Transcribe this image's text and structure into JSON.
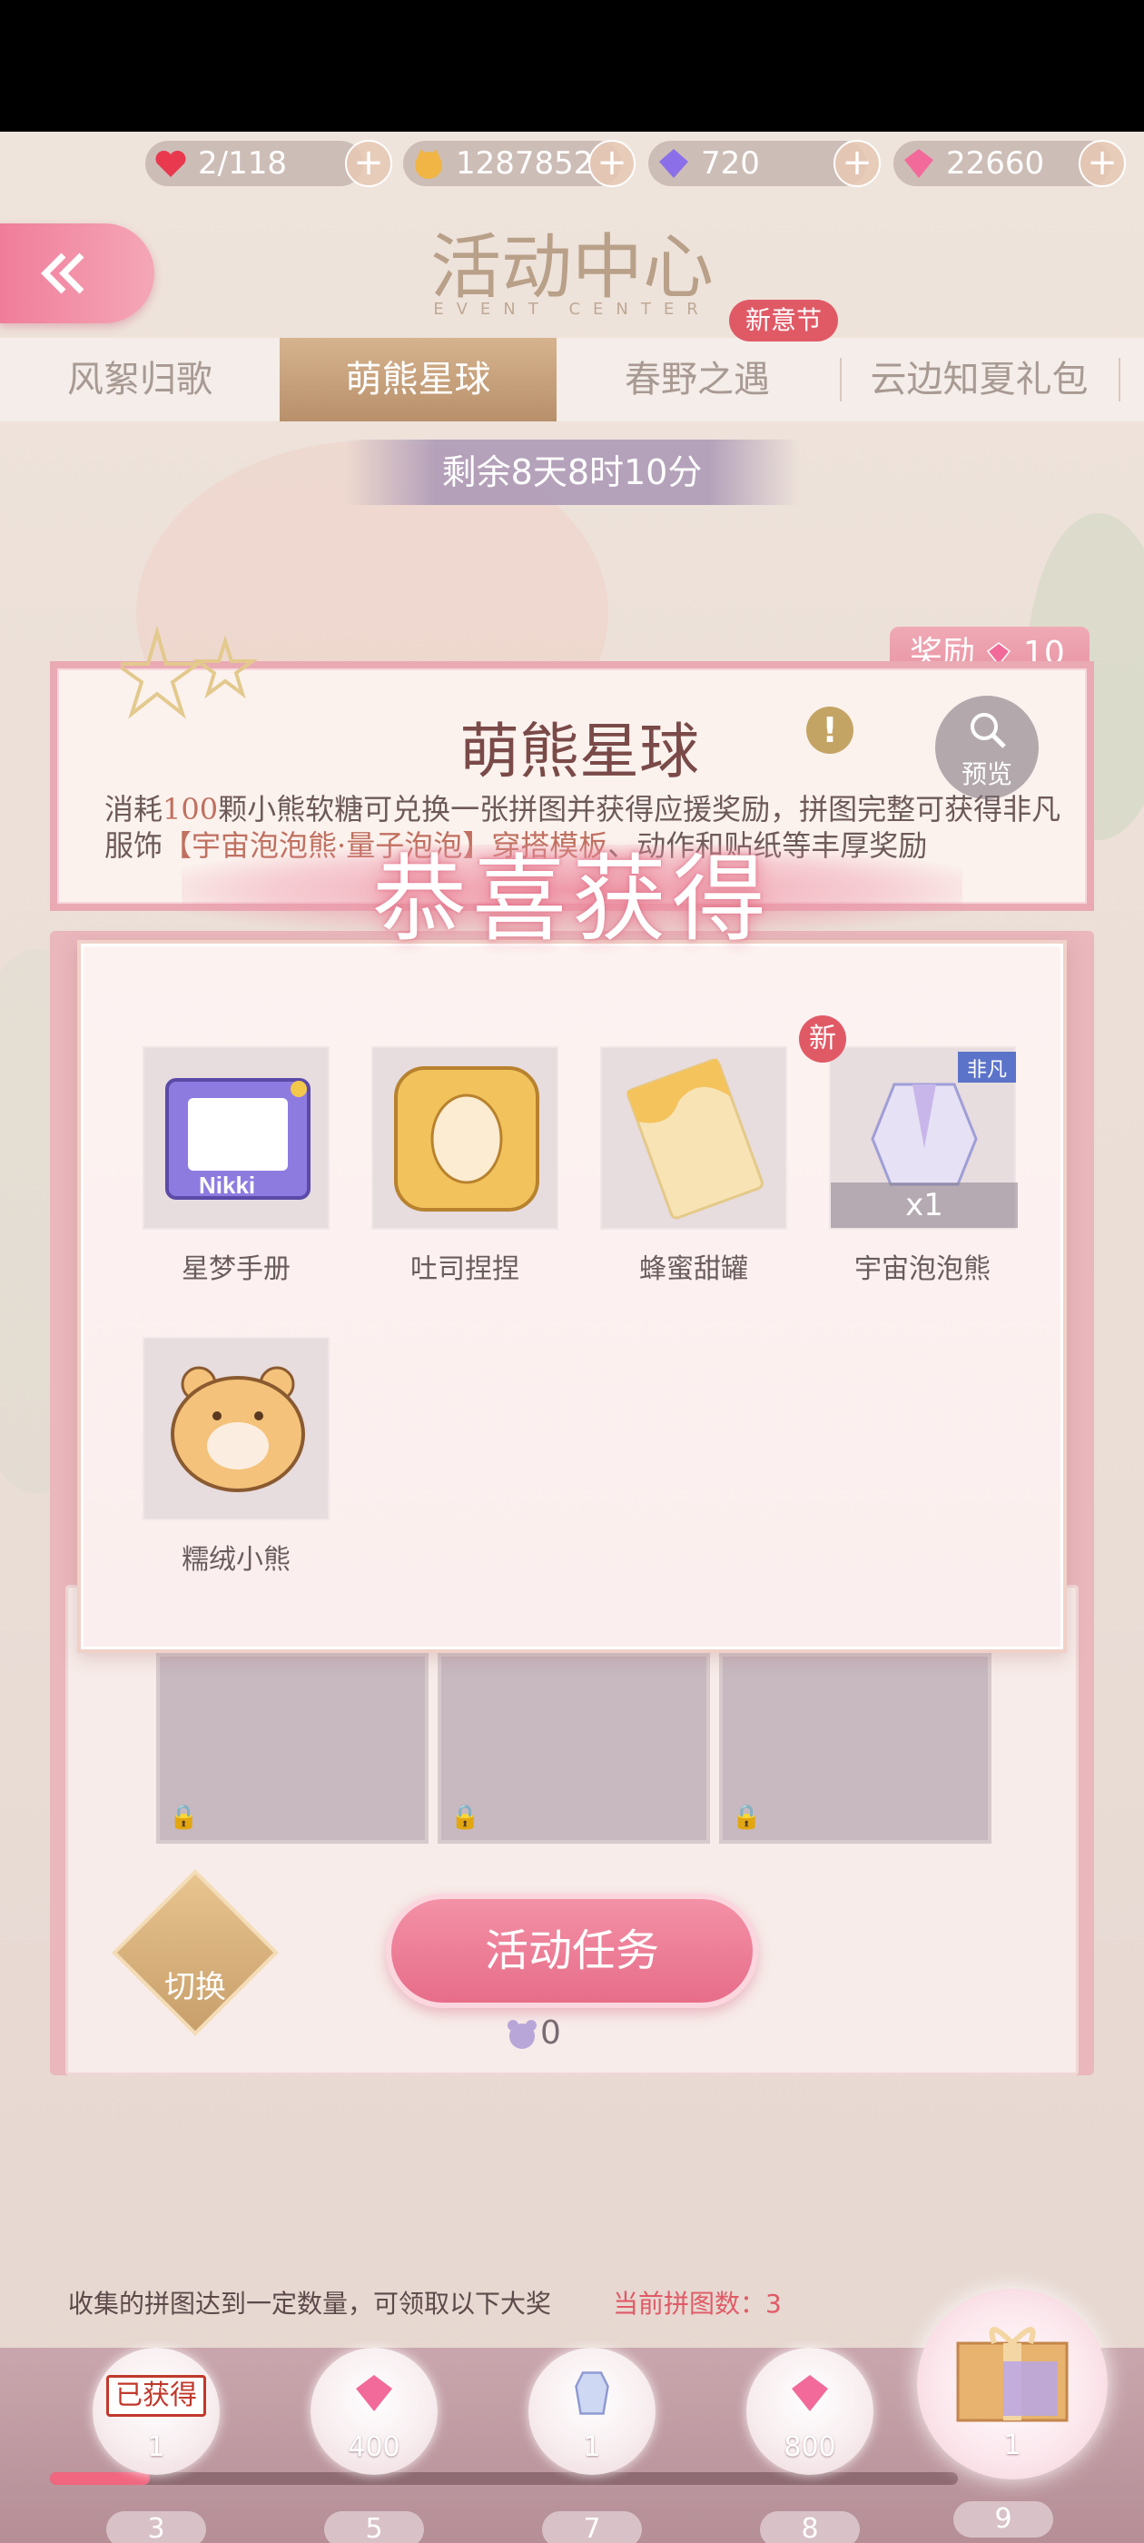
{
  "resources": [
    {
      "icon": "heart-icon",
      "value": "2/118"
    },
    {
      "icon": "coin-icon",
      "value": "1287852"
    },
    {
      "icon": "purple-diamond-icon",
      "value": "720"
    },
    {
      "icon": "pink-diamond-icon",
      "value": "22660"
    }
  ],
  "header": {
    "title": "活动中心",
    "subtitle": "EVENT CENTER"
  },
  "tabs": [
    {
      "label": "风絮归歌"
    },
    {
      "label": "萌熊星球"
    },
    {
      "label": "春野之遇"
    },
    {
      "label": "云边知夏礼包"
    }
  ],
  "new_badge": "新意节",
  "timer": "剩余8天8时10分",
  "event": {
    "reward_label": "奖励",
    "reward_value": "10",
    "title": "萌熊星球",
    "desc_1": "消耗",
    "desc_num": "100",
    "desc_2": "颗小熊软糖可兑换一张拼图并获得应援奖励，拼图完整可获得非凡服饰",
    "desc_link_1": "【宇宙泡泡熊·",
    "desc_link_2": "量子泡泡】",
    "desc_link_3": "穿搭模板",
    "desc_3": "、动作和贴纸等丰厚奖励",
    "preview_label": "预览"
  },
  "popup": {
    "title": "恭喜获得",
    "items": [
      {
        "label": "星梦手册",
        "icon": "photo-frame-icon"
      },
      {
        "label": "吐司捏捏",
        "icon": "toast-icon"
      },
      {
        "label": "蜂蜜甜罐",
        "icon": "honey-card-icon"
      },
      {
        "label": "宇宙泡泡熊",
        "icon": "outfit-icon",
        "qty": "x1",
        "new": "新",
        "tag": "非凡"
      },
      {
        "label": "糯绒小熊",
        "icon": "bear-icon"
      }
    ]
  },
  "switch_label": "切换",
  "task_button": "活动任务",
  "task_count": "0",
  "collect": {
    "note": "收集的拼图达到一定数量，可领取以下大奖",
    "current_label": "当前拼图数：3"
  },
  "track": {
    "nodes": [
      {
        "value": "1",
        "num": "3",
        "status": "已获得"
      },
      {
        "value": "400",
        "num": "5"
      },
      {
        "value": "1",
        "num": "7"
      },
      {
        "value": "800",
        "num": "8"
      },
      {
        "value": "1",
        "num": "9"
      }
    ],
    "progress": 0.11
  },
  "colors": {
    "accent_pink": "#e76d8a",
    "gold": "#c89f6a",
    "badge_red": "#e05a66"
  }
}
